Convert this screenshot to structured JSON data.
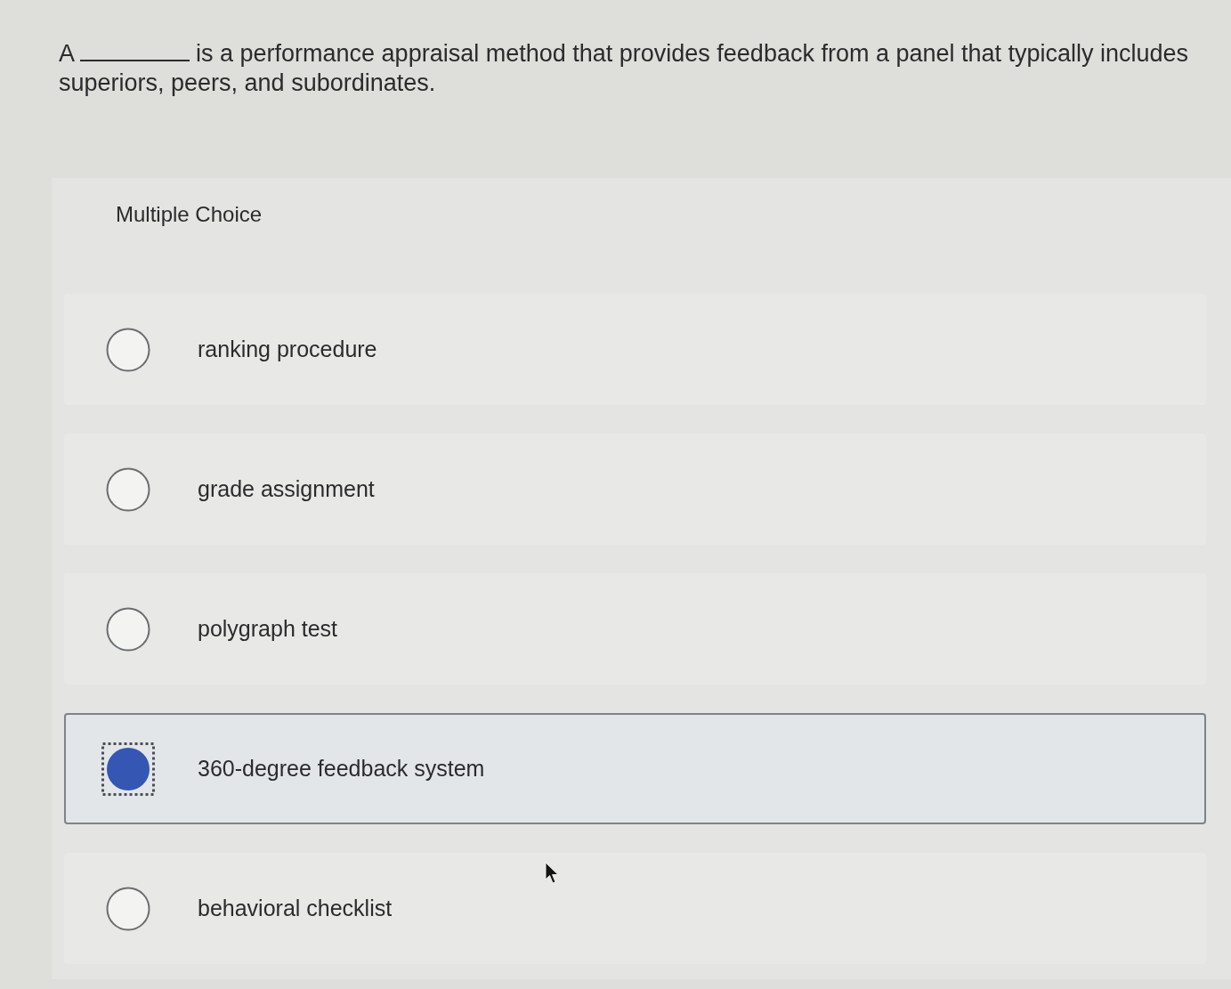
{
  "question": {
    "before": "A",
    "lines": [
      "is a performance appraisal method that provides feedback from a panel that typically includes",
      "superiors, peers, and subordinates."
    ]
  },
  "answer_area": {
    "label": "Multiple Choice",
    "options": [
      {
        "text": "ranking procedure",
        "selected": false
      },
      {
        "text": "grade assignment",
        "selected": false
      },
      {
        "text": "polygraph test",
        "selected": false
      },
      {
        "text": "360-degree feedback system",
        "selected": true
      },
      {
        "text": "behavioral checklist",
        "selected": false
      }
    ]
  }
}
